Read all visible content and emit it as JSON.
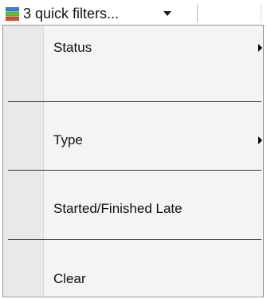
{
  "toolbar": {
    "quick_filters_label": "3 quick filters...",
    "icon": "stacked-filter-icon",
    "caret_icon": "chevron-down-icon",
    "icon_colors": {
      "top": "#3a7fd0",
      "middle": "#5fbf3a",
      "bottom": "#e0482c"
    }
  },
  "menu": {
    "items": [
      {
        "label": "Status",
        "submenu": true
      },
      {
        "label": "Type",
        "submenu": true
      },
      {
        "label": "Started/Finished Late",
        "submenu": false
      },
      {
        "label": "Clear",
        "submenu": false
      }
    ]
  }
}
